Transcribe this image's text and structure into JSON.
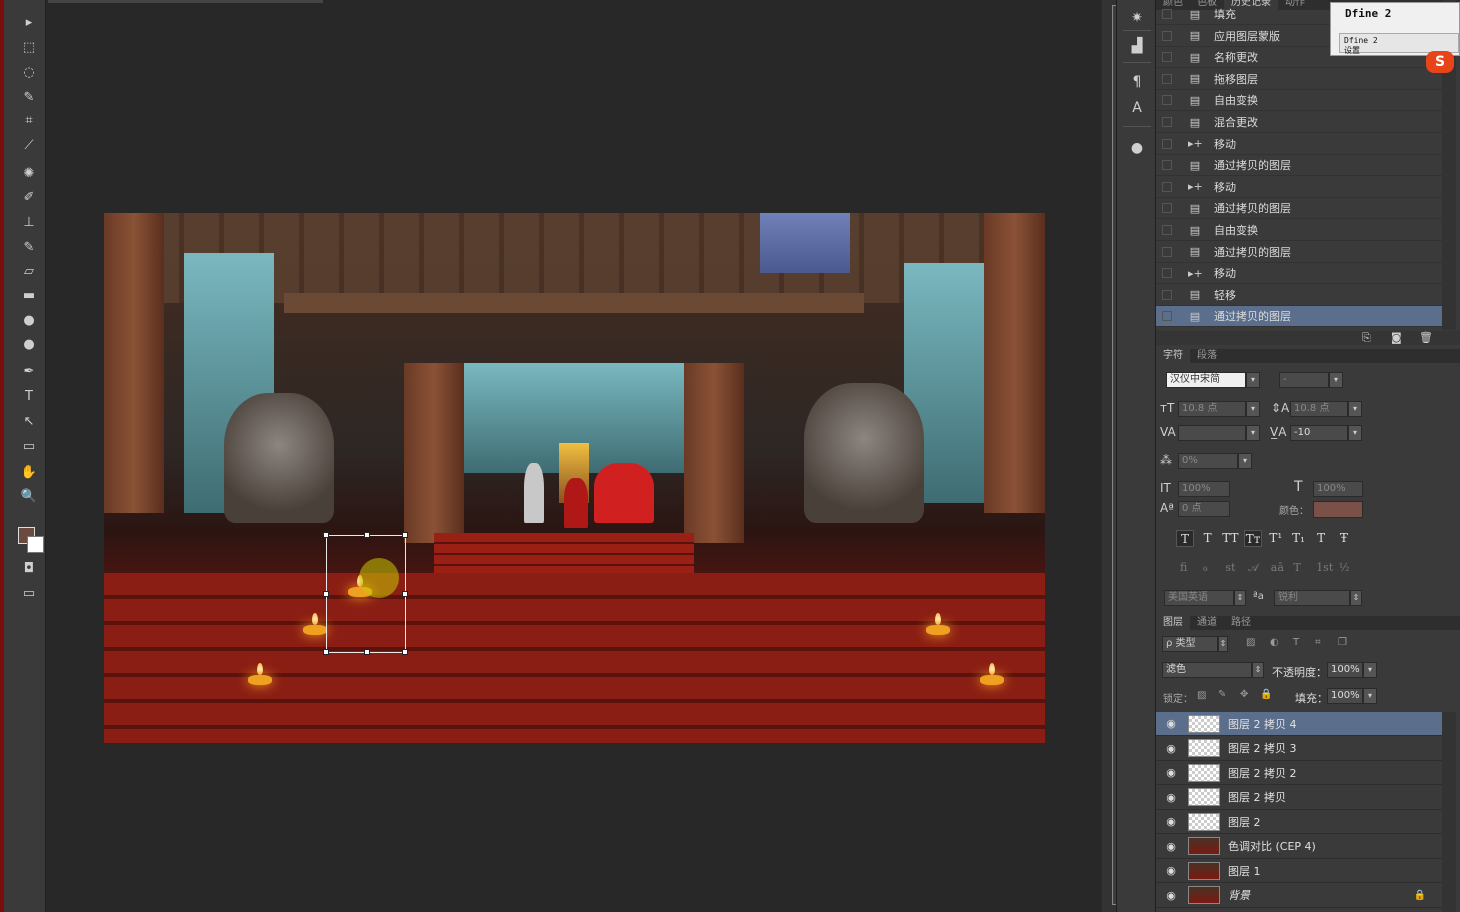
{
  "tools": [
    "move-icon",
    "marquee-icon",
    "lasso-icon",
    "quick-select-icon",
    "crop-icon",
    "eyedropper-icon",
    "healing-icon",
    "brush-icon",
    "stamp-icon",
    "history-brush-icon",
    "eraser-icon",
    "gradient-icon",
    "blur-icon",
    "dodge-icon",
    "pen-icon",
    "type-icon",
    "path-select-icon",
    "shape-icon",
    "hand-icon",
    "zoom-icon"
  ],
  "tool_glyphs": [
    "▸",
    "⬚",
    "◌",
    "✎",
    "⌗",
    "⟋",
    "✺",
    "✐",
    "⊥",
    "✎",
    "▱",
    "▬",
    "●",
    "●",
    "✒",
    "T",
    "↖",
    "▭",
    "✋",
    "🔍"
  ],
  "colors": {
    "foreground": "#6b4a40",
    "background": "#ffffff",
    "selection": "#5b6f8d",
    "accent_red": "#7a0e0e"
  },
  "right_tabs_top": [
    "颜色",
    "色板",
    "历史记录",
    "动作"
  ],
  "history": {
    "items": [
      {
        "icon": "doc",
        "label": "填充"
      },
      {
        "icon": "doc",
        "label": "应用图层蒙版"
      },
      {
        "icon": "doc",
        "label": "名称更改"
      },
      {
        "icon": "doc",
        "label": "拖移图层"
      },
      {
        "icon": "doc",
        "label": "自由变换"
      },
      {
        "icon": "doc",
        "label": "混合更改"
      },
      {
        "icon": "move",
        "label": "移动"
      },
      {
        "icon": "doc",
        "label": "通过拷贝的图层"
      },
      {
        "icon": "move",
        "label": "移动"
      },
      {
        "icon": "doc",
        "label": "通过拷贝的图层"
      },
      {
        "icon": "doc",
        "label": "自由变换"
      },
      {
        "icon": "doc",
        "label": "通过拷贝的图层"
      },
      {
        "icon": "move",
        "label": "移动"
      },
      {
        "icon": "doc",
        "label": "轻移"
      },
      {
        "icon": "doc",
        "label": "通过拷贝的图层"
      }
    ]
  },
  "dfine": {
    "title": "Dfine 2",
    "sub1": "Dfine 2",
    "sub2": "设置"
  },
  "sogou": "S",
  "character": {
    "tabs": [
      "字符",
      "段落"
    ],
    "font_family": "汉仪中宋简",
    "font_style": "-",
    "size": "10.8 点",
    "leading": "10.8 点",
    "kerning": "",
    "tracking": "-10",
    "scale_pct": "0%",
    "vscale": "100%",
    "hscale": "100%",
    "baseline": "0 点",
    "color_label": "颜色：",
    "color_swatch": "#7a5048",
    "style_buttons": [
      "T",
      "T",
      "TT",
      "Tт",
      "T¹",
      "T₁",
      "T",
      "Ŧ"
    ],
    "opentype_buttons": [
      "fi",
      "ℴ",
      "st",
      "𝒜",
      "aā",
      "T",
      "1st",
      "½"
    ],
    "language": "美国英语",
    "aa_label": "ªa",
    "antialias": "锐利"
  },
  "layers": {
    "tabs": [
      "图层",
      "通道",
      "路径"
    ],
    "filter_kind": "ρ 类型",
    "blend_mode": "滤色",
    "opacity_label": "不透明度：",
    "opacity": "100%",
    "lock_label": "锁定：",
    "fill_label": "填充：",
    "fill": "100%",
    "items": [
      {
        "name": "图层 2 拷贝 4",
        "thumb": "trans",
        "selected": true
      },
      {
        "name": "图层 2 拷贝 3",
        "thumb": "trans"
      },
      {
        "name": "图层 2 拷贝 2",
        "thumb": "trans"
      },
      {
        "name": "图层 2 拷贝",
        "thumb": "trans"
      },
      {
        "name": "图层 2",
        "thumb": "trans"
      },
      {
        "name": "色调对比 (CEP 4)",
        "thumb": "img"
      },
      {
        "name": "图层 1",
        "thumb": "img"
      },
      {
        "name": "背景",
        "thumb": "img",
        "italic": true,
        "locked": true
      }
    ]
  }
}
